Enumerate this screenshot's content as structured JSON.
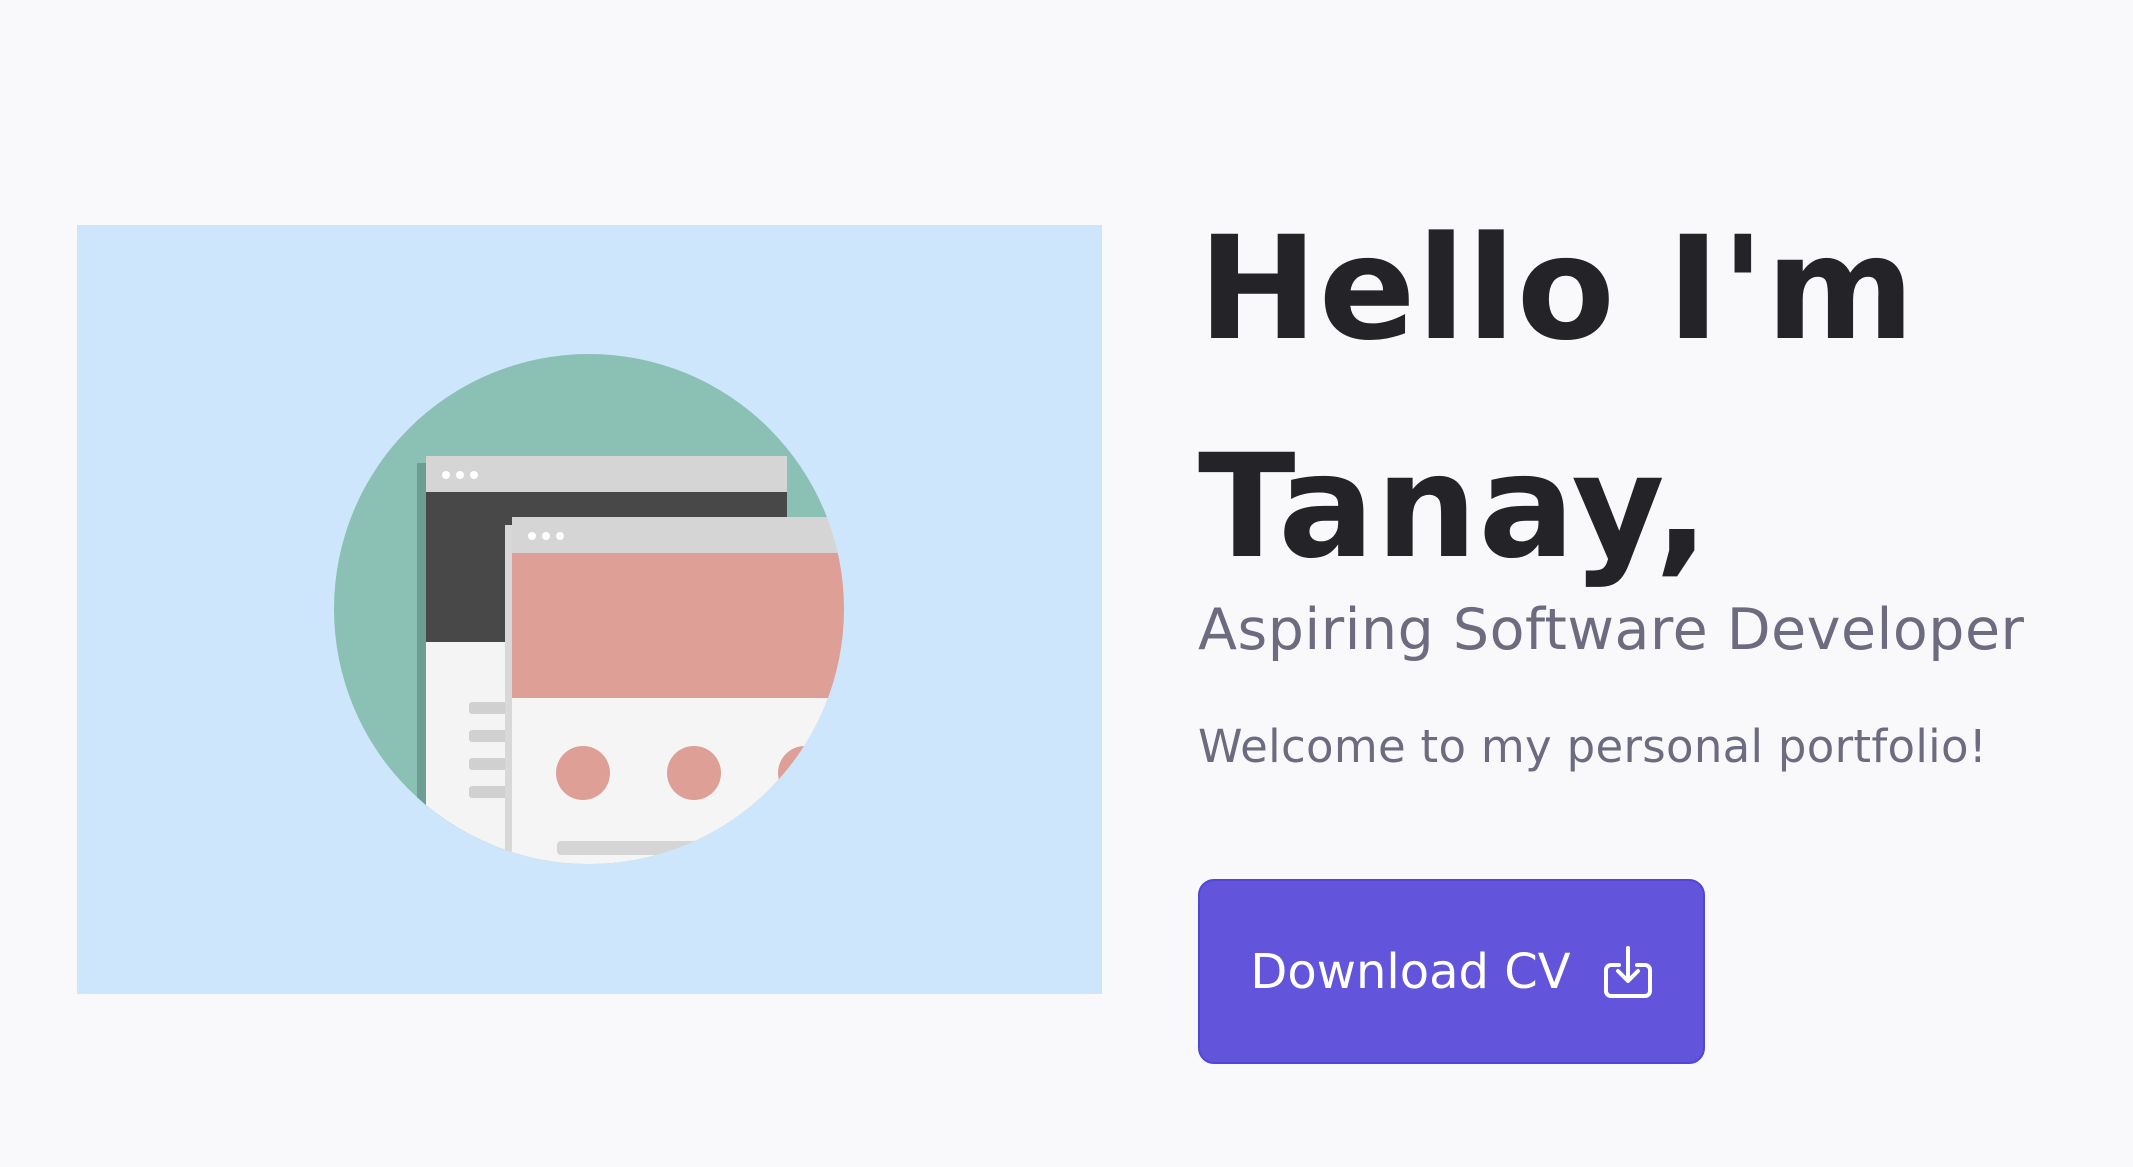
{
  "hero": {
    "illustration_icon": "browser-windows-illustration",
    "background_color": "#cde6fb",
    "circle_color": "#8bc0b4"
  },
  "intro": {
    "greeting_line1": "Hello I'm",
    "greeting_line2": "Tanay,",
    "role": "Aspiring Software Developer",
    "welcome": "Welcome to my personal portfolio!"
  },
  "cta": {
    "label": "Download CV",
    "icon": "download-icon",
    "color": "#6255dc"
  },
  "colors": {
    "page_background": "#f9f9fb",
    "heading": "#232328",
    "muted_text": "#6c6b80"
  }
}
